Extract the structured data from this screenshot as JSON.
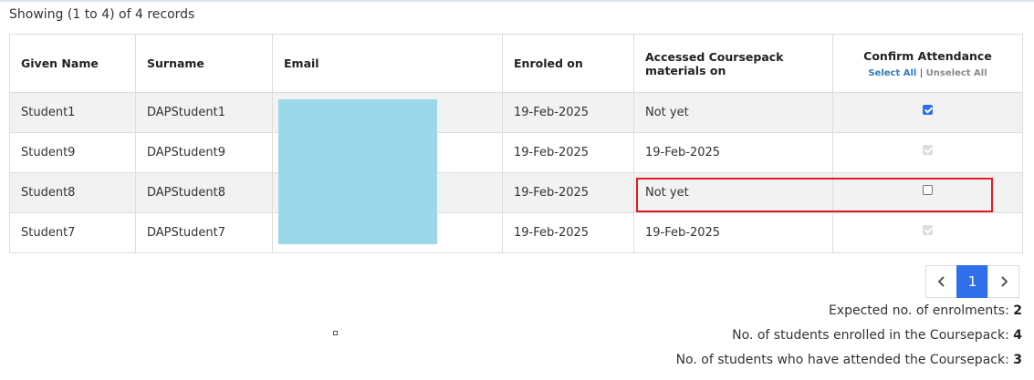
{
  "summary": {
    "showing_text": "Showing (1 to 4) of 4 records"
  },
  "table": {
    "headers": {
      "given_name": "Given Name",
      "surname": "Surname",
      "email": "Email",
      "enroled_on": "Enroled on",
      "accessed": "Accessed Coursepack materials on",
      "confirm": "Confirm Attendance",
      "select_all": "Select All",
      "separator": "|",
      "unselect_all": "Unselect All"
    },
    "rows": [
      {
        "given_name": "Student1",
        "surname": "DAPStudent1",
        "enroled_on": "19-Feb-2025",
        "accessed": "Not yet",
        "attendance": "checked"
      },
      {
        "given_name": "Student9",
        "surname": "DAPStudent9",
        "enroled_on": "19-Feb-2025",
        "accessed": "19-Feb-2025",
        "attendance": "checked-disabled"
      },
      {
        "given_name": "Student8",
        "surname": "DAPStudent8",
        "enroled_on": "19-Feb-2025",
        "accessed": "Not yet",
        "attendance": "unchecked"
      },
      {
        "given_name": "Student7",
        "surname": "DAPStudent7",
        "enroled_on": "19-Feb-2025",
        "accessed": "19-Feb-2025",
        "attendance": "checked-disabled"
      }
    ]
  },
  "pagination": {
    "prev_icon": "chevron-left-icon",
    "current_page": "1",
    "next_icon": "chevron-right-icon"
  },
  "stats": {
    "expected_label": "Expected no. of enrolments:",
    "expected_value": "2",
    "enrolled_label": "No. of students enrolled in the Coursepack:",
    "enrolled_value": "4",
    "attended_label": "No. of students who have attended the Coursepack:",
    "attended_value": "3"
  },
  "colors": {
    "accent": "#2f6fea",
    "highlight": "#e01b24",
    "redaction": "#9ad8ea",
    "link": "#337ab7"
  }
}
